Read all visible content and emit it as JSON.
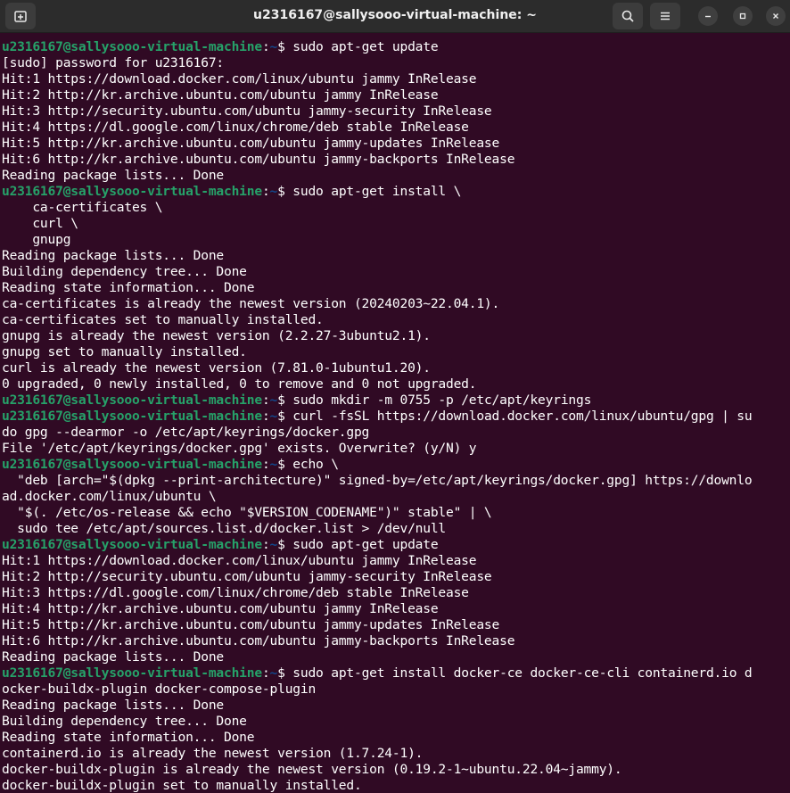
{
  "window": {
    "title": "u2316167@sallysooo-virtual-machine: ~",
    "buttons": {
      "new_tab": "new-tab-icon",
      "search": "search-icon",
      "menu": "hamburger-menu-icon",
      "minimize": "minimize-icon",
      "maximize": "maximize-icon",
      "close": "close-icon"
    }
  },
  "colors": {
    "background": "#300a24",
    "titlebar": "#2c2c2c",
    "prompt_user": "#26a269",
    "prompt_path": "#12488b",
    "text": "#ffffff"
  },
  "prompt": {
    "user": "u2316167@sallysooo-virtual-machine",
    "path": "~"
  },
  "lines": [
    {
      "t": "prompt",
      "cmd": "sudo apt-get update"
    },
    {
      "t": "out",
      "text": "[sudo] password for u2316167:"
    },
    {
      "t": "out",
      "text": "Hit:1 https://download.docker.com/linux/ubuntu jammy InRelease"
    },
    {
      "t": "out",
      "text": "Hit:2 http://kr.archive.ubuntu.com/ubuntu jammy InRelease"
    },
    {
      "t": "out",
      "text": "Hit:3 http://security.ubuntu.com/ubuntu jammy-security InRelease"
    },
    {
      "t": "out",
      "text": "Hit:4 https://dl.google.com/linux/chrome/deb stable InRelease"
    },
    {
      "t": "out",
      "text": "Hit:5 http://kr.archive.ubuntu.com/ubuntu jammy-updates InRelease"
    },
    {
      "t": "out",
      "text": "Hit:6 http://kr.archive.ubuntu.com/ubuntu jammy-backports InRelease"
    },
    {
      "t": "out",
      "text": "Reading package lists... Done"
    },
    {
      "t": "prompt",
      "cmd": "sudo apt-get install \\"
    },
    {
      "t": "out",
      "text": "    ca-certificates \\"
    },
    {
      "t": "out",
      "text": "    curl \\"
    },
    {
      "t": "out",
      "text": "    gnupg"
    },
    {
      "t": "out",
      "text": "Reading package lists... Done"
    },
    {
      "t": "out",
      "text": "Building dependency tree... Done"
    },
    {
      "t": "out",
      "text": "Reading state information... Done"
    },
    {
      "t": "out",
      "text": "ca-certificates is already the newest version (20240203~22.04.1)."
    },
    {
      "t": "out",
      "text": "ca-certificates set to manually installed."
    },
    {
      "t": "out",
      "text": "gnupg is already the newest version (2.2.27-3ubuntu2.1)."
    },
    {
      "t": "out",
      "text": "gnupg set to manually installed."
    },
    {
      "t": "out",
      "text": "curl is already the newest version (7.81.0-1ubuntu1.20)."
    },
    {
      "t": "out",
      "text": "0 upgraded, 0 newly installed, 0 to remove and 0 not upgraded."
    },
    {
      "t": "prompt",
      "cmd": "sudo mkdir -m 0755 -p /etc/apt/keyrings"
    },
    {
      "t": "prompt",
      "cmd": "curl -fsSL https://download.docker.com/linux/ubuntu/gpg | su"
    },
    {
      "t": "out",
      "text": "do gpg --dearmor -o /etc/apt/keyrings/docker.gpg"
    },
    {
      "t": "out",
      "text": "File '/etc/apt/keyrings/docker.gpg' exists. Overwrite? (y/N) y"
    },
    {
      "t": "prompt",
      "cmd": "echo \\"
    },
    {
      "t": "out",
      "text": "  \"deb [arch=\"$(dpkg --print-architecture)\" signed-by=/etc/apt/keyrings/docker.gpg] https://downlo"
    },
    {
      "t": "out",
      "text": "ad.docker.com/linux/ubuntu \\"
    },
    {
      "t": "out",
      "text": "  \"$(. /etc/os-release && echo \"$VERSION_CODENAME\")\" stable\" | \\"
    },
    {
      "t": "out",
      "text": "  sudo tee /etc/apt/sources.list.d/docker.list > /dev/null"
    },
    {
      "t": "prompt",
      "cmd": "sudo apt-get update"
    },
    {
      "t": "out",
      "text": "Hit:1 https://download.docker.com/linux/ubuntu jammy InRelease"
    },
    {
      "t": "out",
      "text": "Hit:2 http://security.ubuntu.com/ubuntu jammy-security InRelease"
    },
    {
      "t": "out",
      "text": "Hit:3 https://dl.google.com/linux/chrome/deb stable InRelease"
    },
    {
      "t": "out",
      "text": "Hit:4 http://kr.archive.ubuntu.com/ubuntu jammy InRelease"
    },
    {
      "t": "out",
      "text": "Hit:5 http://kr.archive.ubuntu.com/ubuntu jammy-updates InRelease"
    },
    {
      "t": "out",
      "text": "Hit:6 http://kr.archive.ubuntu.com/ubuntu jammy-backports InRelease"
    },
    {
      "t": "out",
      "text": "Reading package lists... Done"
    },
    {
      "t": "prompt",
      "cmd": "sudo apt-get install docker-ce docker-ce-cli containerd.io d"
    },
    {
      "t": "out",
      "text": "ocker-buildx-plugin docker-compose-plugin"
    },
    {
      "t": "out",
      "text": "Reading package lists... Done"
    },
    {
      "t": "out",
      "text": "Building dependency tree... Done"
    },
    {
      "t": "out",
      "text": "Reading state information... Done"
    },
    {
      "t": "out",
      "text": "containerd.io is already the newest version (1.7.24-1)."
    },
    {
      "t": "out",
      "text": "docker-buildx-plugin is already the newest version (0.19.2-1~ubuntu.22.04~jammy)."
    },
    {
      "t": "out",
      "text": "docker-buildx-plugin set to manually installed."
    }
  ]
}
